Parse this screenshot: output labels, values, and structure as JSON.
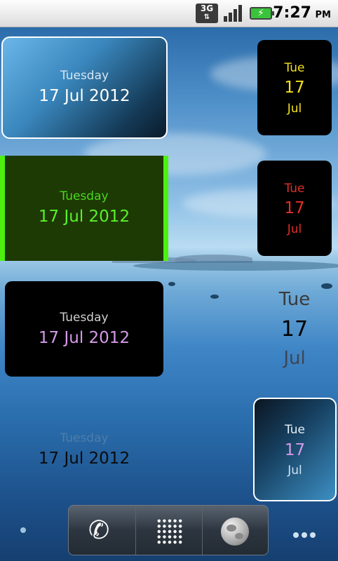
{
  "statusbar": {
    "network_icon": "3g-icon",
    "network_label": "3G",
    "signal_icon": "signal-bars-icon",
    "battery_icon": "battery-charging-icon",
    "time": "7:27",
    "ampm": "PM"
  },
  "widgets": {
    "large_blue": {
      "day": "Tuesday",
      "date": "17 Jul 2012"
    },
    "large_green": {
      "day": "Tuesday",
      "date": "17 Jul 2012"
    },
    "large_black": {
      "day": "Tuesday",
      "date": "17 Jul 2012"
    },
    "large_transparent": {
      "day": "Tuesday",
      "date": "17 Jul 2012"
    },
    "small_yellow": {
      "day": "Tue",
      "num": "17",
      "month": "Jul"
    },
    "small_red": {
      "day": "Tue",
      "num": "17",
      "month": "Jul"
    },
    "small_transparent": {
      "day": "Tue",
      "num": "17",
      "month": "Jul"
    },
    "small_blue": {
      "day": "Tue",
      "num": "17",
      "month": "Jul"
    }
  },
  "dock": {
    "phone_icon": "phone-icon",
    "apps_icon": "app-drawer-icon",
    "browser_icon": "browser-globe-icon"
  },
  "colors": {
    "green_accent": "#4ef010",
    "yellow_text": "#f2e020",
    "red_text": "#e0302a",
    "purple_text": "#d59ae8"
  }
}
